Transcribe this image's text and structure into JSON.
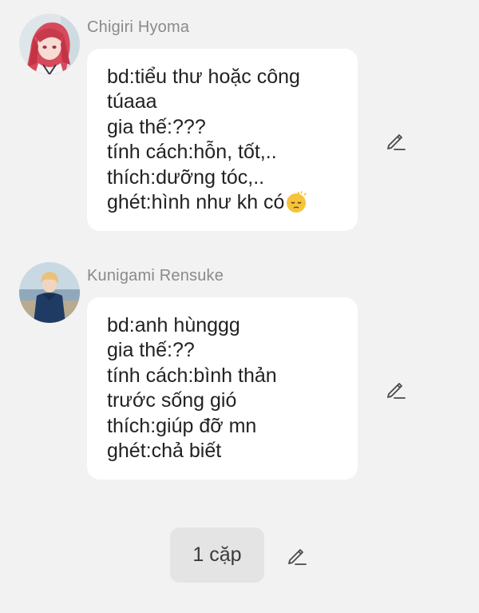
{
  "messages": [
    {
      "sender": "Chigiri Hyoma",
      "avatar_icon": "avatar-red-hair-character",
      "lines": [
        "bd:tiểu thư hoặc công",
        "túaaa",
        "gia thế:???",
        "tính cách:hỗn, tốt,..",
        "thích:dưỡng tóc,..",
        "ghét:hình như kh có"
      ],
      "trailing_emoji": "😔",
      "edit_icon": "pencil-icon"
    },
    {
      "sender": "Kunigami Rensuke",
      "avatar_icon": "avatar-blond-character-seaside",
      "lines": [
        "bd:anh hùnggg",
        "gia thế:??",
        "tính cách:bình thản",
        "trước sống gió",
        "thích:giúp đỡ mn",
        "ghét:chả biết"
      ],
      "edit_icon": "pencil-icon"
    }
  ],
  "footer": {
    "pair_label": "1 cặp",
    "edit_icon": "pencil-icon"
  },
  "colors": {
    "background": "#f2f2f2",
    "bubble": "#ffffff",
    "sender_name": "#8a8a8a",
    "pair_button": "#e4e4e4"
  }
}
